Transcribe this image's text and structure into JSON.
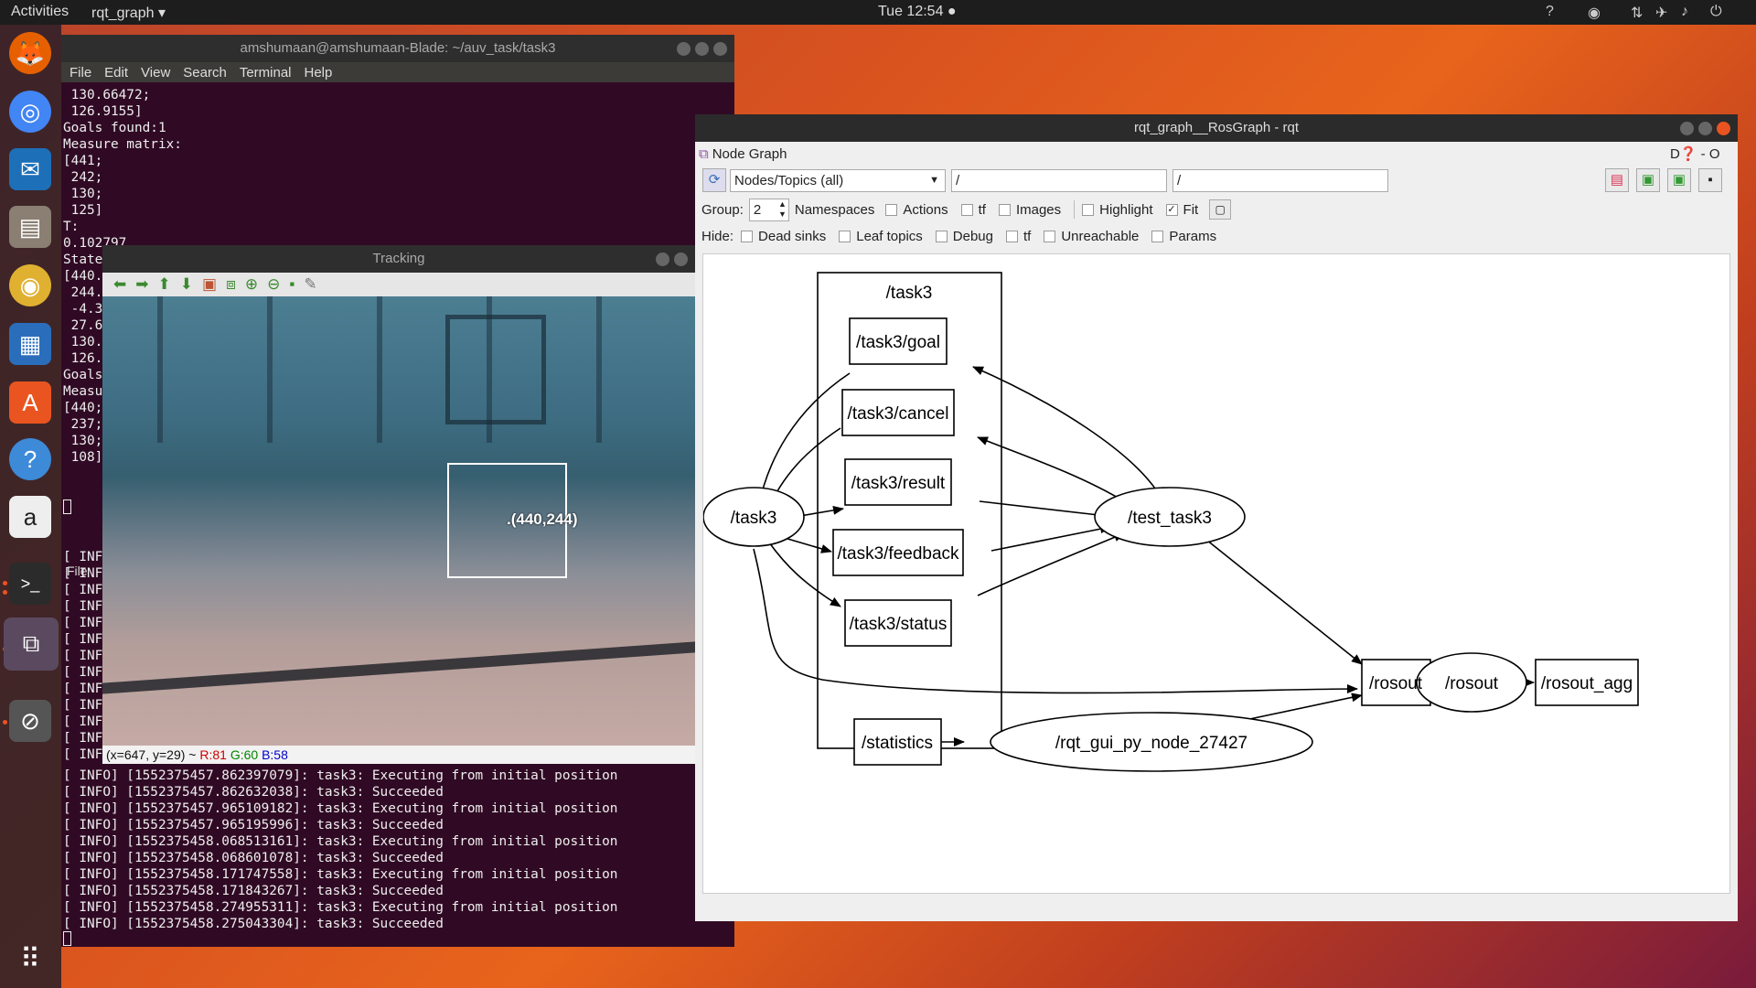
{
  "topbar": {
    "activities": "Activities",
    "app_menu": "rqt_graph ▾",
    "clock": "Tue 12:54 ●"
  },
  "terminal": {
    "title": "amshumaan@amshumaan-Blade: ~/auv_task/task3",
    "menu": [
      "File",
      "Edit",
      "View",
      "Search",
      "Terminal",
      "Help"
    ],
    "lines_top": [
      " 130.66472;",
      " 126.9155]",
      "Goals found:1",
      "Measure matrix:",
      "[441;",
      " 242;",
      " 130;",
      " 125]",
      "T:",
      "0.102797",
      "State",
      "[440.",
      " 244.",
      " -4.3",
      " 27.6",
      " 130.",
      " 126.",
      "Goals",
      "Measu",
      "[440;",
      " 237;",
      " 130;",
      " 108]"
    ],
    "second_menu_file": "File",
    "info_short": [
      "[ INFO",
      "[ INFO",
      "[ INFO",
      "[ INFO",
      "[ INFO",
      "[ INFO",
      "[ INFO",
      "[ INFO",
      "[ INFO",
      "[ INFO",
      "[ INFO",
      "[ INFO",
      "[ INFO"
    ],
    "info_lines": [
      "[ INFO] [1552375457.862397079]: task3: Executing from initial position",
      "[ INFO] [1552375457.862632038]: task3: Succeeded",
      "[ INFO] [1552375457.965109182]: task3: Executing from initial position",
      "[ INFO] [1552375457.965195996]: task3: Succeeded",
      "[ INFO] [1552375458.068513161]: task3: Executing from initial position",
      "[ INFO] [1552375458.068601078]: task3: Succeeded",
      "[ INFO] [1552375458.171747558]: task3: Executing from initial position",
      "[ INFO] [1552375458.171843267]: task3: Succeeded",
      "[ INFO] [1552375458.274955311]: task3: Executing from initial position",
      "[ INFO] [1552375458.275043304]: task3: Succeeded"
    ]
  },
  "tracking": {
    "title": "Tracking",
    "label": ".(440,244)",
    "status_coords": "(x=647, y=29) ~",
    "status_r": "R:81",
    "status_g": "G:60",
    "status_b": "B:58"
  },
  "rqt": {
    "title": "rqt_graph__RosGraph - rqt",
    "plugin_title": "Node Graph",
    "plugin_controls": "D❓  -  O",
    "mode_select": "Nodes/Topics (all)",
    "filter1": "/",
    "filter2": "/",
    "group_label": "Group:",
    "group_value": "2",
    "options": [
      "Namespaces",
      "Actions",
      "tf",
      "Images",
      "Highlight",
      "Fit"
    ],
    "hide_label": "Hide:",
    "hide_options": [
      "Dead sinks",
      "Leaf topics",
      "Debug",
      "tf",
      "Unreachable",
      "Params"
    ]
  },
  "graph": {
    "cluster": "/task3",
    "nodes": {
      "task3": "/task3",
      "goal": "/task3/goal",
      "cancel": "/task3/cancel",
      "result": "/task3/result",
      "feedback": "/task3/feedback",
      "status": "/task3/status",
      "test_task3": "/test_task3",
      "rosout_topic": "/rosout",
      "rosout_node": "/rosout",
      "rosout_agg": "/rosout_agg",
      "statistics": "/statistics",
      "rqt_gui": "/rqt_gui_py_node_27427"
    }
  },
  "colors": {
    "terminal_bg": "#300a24",
    "accent": "#e95420"
  }
}
